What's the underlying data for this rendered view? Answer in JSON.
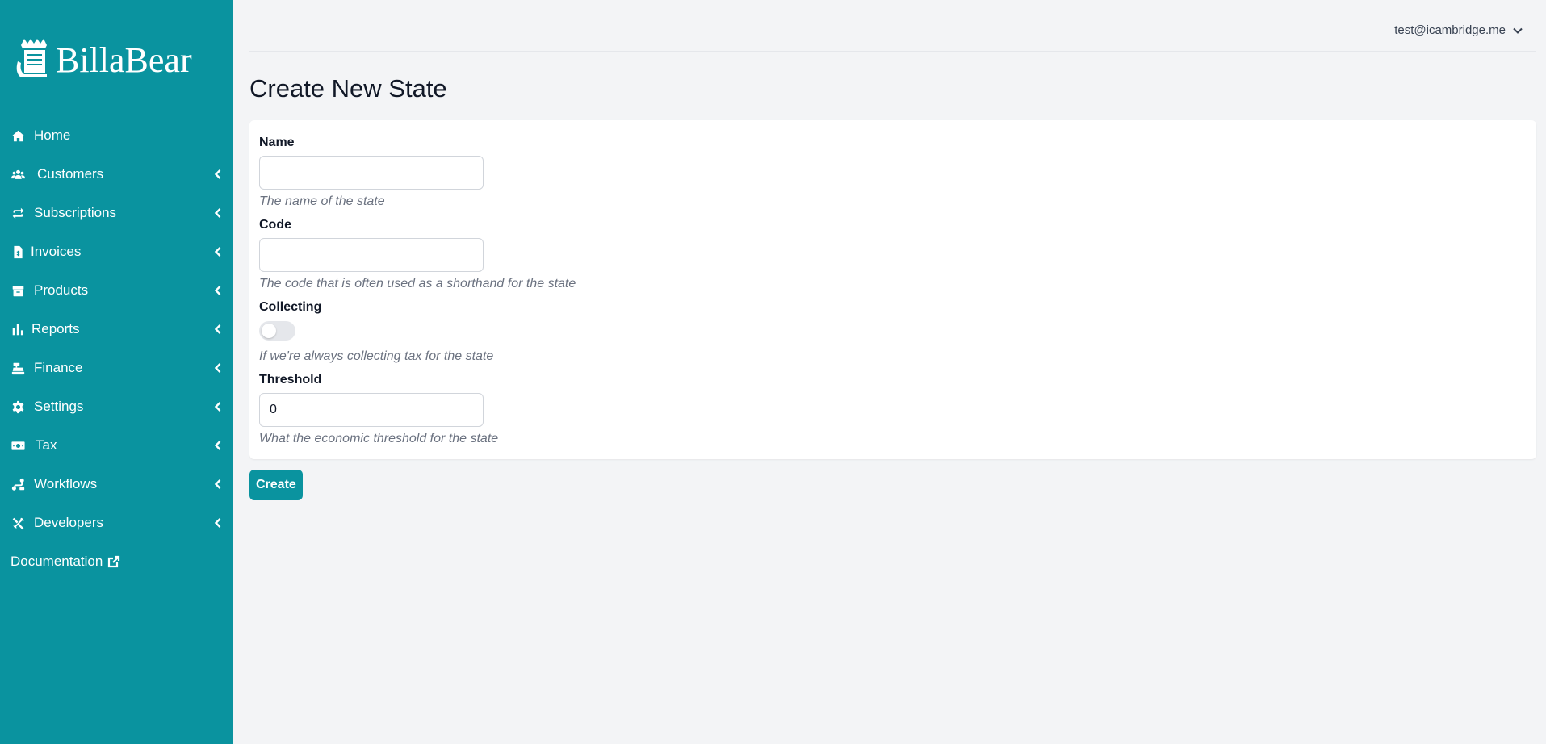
{
  "app": {
    "name": "BillaBear"
  },
  "sidebar": {
    "items": [
      {
        "label": "Home",
        "icon": "home-icon",
        "expandable": false
      },
      {
        "label": "Customers",
        "icon": "users-icon",
        "expandable": true
      },
      {
        "label": "Subscriptions",
        "icon": "repeat-icon",
        "expandable": true
      },
      {
        "label": "Invoices",
        "icon": "invoice-icon",
        "expandable": true
      },
      {
        "label": "Products",
        "icon": "box-icon",
        "expandable": true
      },
      {
        "label": "Reports",
        "icon": "chart-icon",
        "expandable": true
      },
      {
        "label": "Finance",
        "icon": "cash-register-icon",
        "expandable": true
      },
      {
        "label": "Settings",
        "icon": "gear-icon",
        "expandable": true
      },
      {
        "label": "Tax",
        "icon": "money-bill-icon",
        "expandable": true
      },
      {
        "label": "Workflows",
        "icon": "workflow-icon",
        "expandable": true
      },
      {
        "label": "Developers",
        "icon": "tools-icon",
        "expandable": true
      }
    ],
    "documentation": {
      "label": "Documentation",
      "icon": "external-link-icon"
    }
  },
  "header": {
    "user_email": "test@icambridge.me"
  },
  "page": {
    "title": "Create New State"
  },
  "form": {
    "name": {
      "label": "Name",
      "value": "",
      "help": "The name of the state"
    },
    "code": {
      "label": "Code",
      "value": "",
      "help": "The code that is often used as a shorthand for the state"
    },
    "collecting": {
      "label": "Collecting",
      "value": false,
      "help": "If we're always collecting tax for the state"
    },
    "threshold": {
      "label": "Threshold",
      "value": "0",
      "help": "What the economic threshold for the state"
    },
    "submit_label": "Create"
  },
  "colors": {
    "brand": "#0a939f",
    "background": "#f3f4f6"
  }
}
